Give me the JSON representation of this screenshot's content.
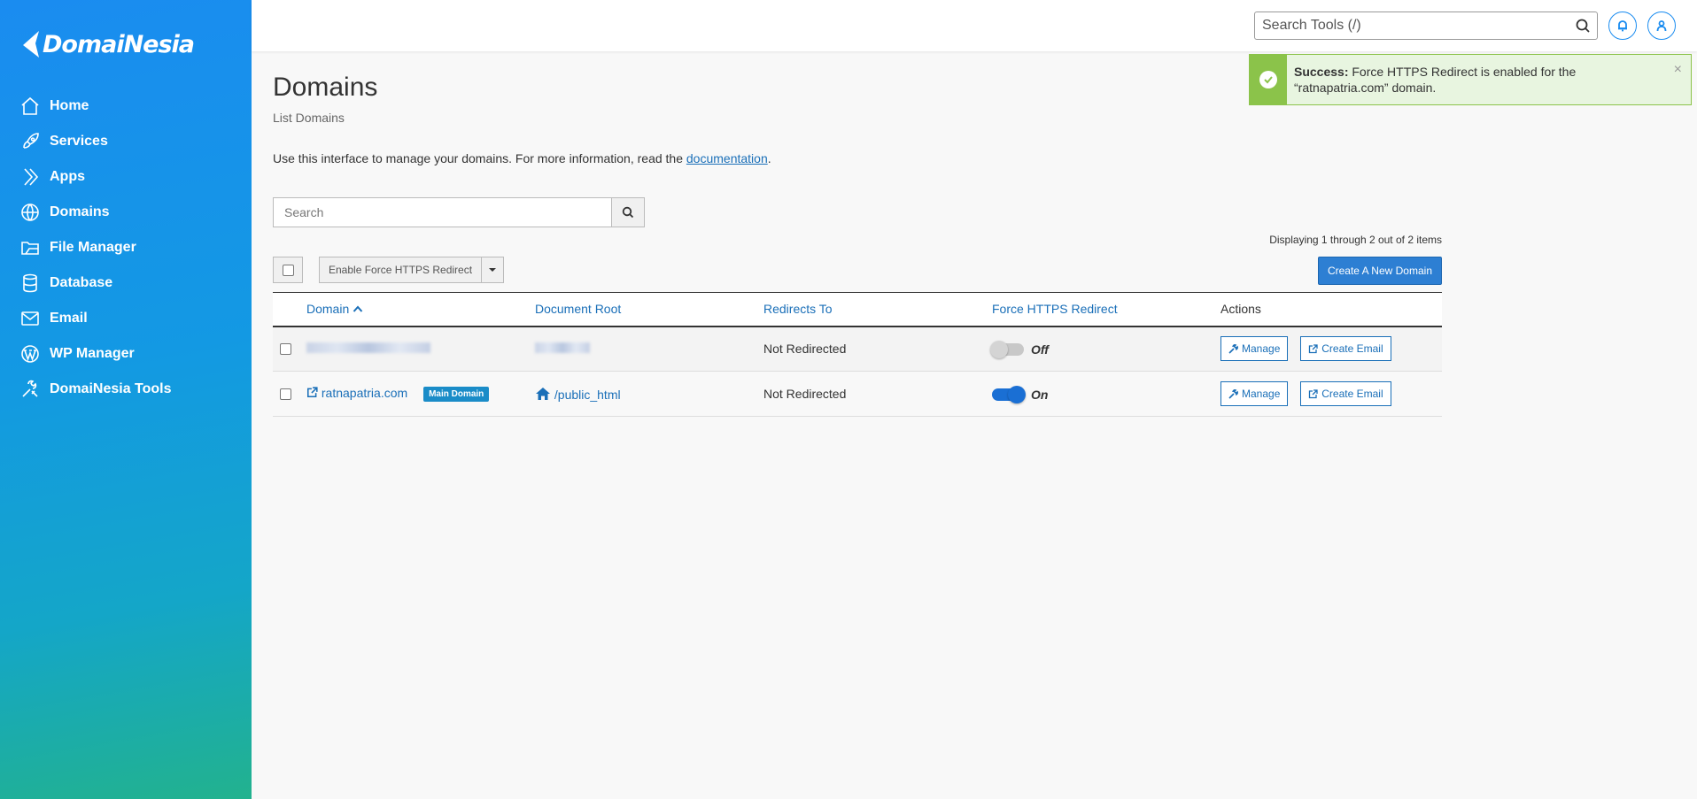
{
  "app": {
    "logo_text": "DomaiNesia"
  },
  "sidebar": {
    "items": [
      {
        "label": "Home",
        "icon": "home-icon"
      },
      {
        "label": "Services",
        "icon": "rocket-icon"
      },
      {
        "label": "Apps",
        "icon": "apps-icon"
      },
      {
        "label": "Domains",
        "icon": "globe-icon"
      },
      {
        "label": "File Manager",
        "icon": "file-manager-icon"
      },
      {
        "label": "Database",
        "icon": "database-icon"
      },
      {
        "label": "Email",
        "icon": "mail-icon"
      },
      {
        "label": "WP Manager",
        "icon": "wordpress-icon"
      },
      {
        "label": "DomaiNesia Tools",
        "icon": "tools-icon"
      }
    ]
  },
  "header": {
    "search_placeholder": "Search Tools (/)"
  },
  "alert": {
    "title": "Success:",
    "message": "Force HTTPS Redirect is enabled for the “ratnapatria.com” domain.",
    "close": "×"
  },
  "main": {
    "title": "Domains",
    "subtitle": "List Domains",
    "intro_text": "Use this interface to manage your domains. For more information, read the ",
    "intro_link": "documentation",
    "intro_end": ".",
    "search_placeholder": "Search",
    "displaying": "Displaying 1 through 2 out of 2 items",
    "bulk_action": "Enable Force HTTPS Redirect",
    "create_button": "Create A New Domain"
  },
  "table": {
    "headers": {
      "domain": "Domain",
      "document_root": "Document Root",
      "redirects_to": "Redirects To",
      "force_https": "Force HTTPS Redirect",
      "actions": "Actions"
    },
    "rows": [
      {
        "domain": "",
        "document_root": "",
        "redirects_to": "Not Redirected",
        "force_https": "Off",
        "manage": "Manage",
        "create_email": "Create Email"
      },
      {
        "domain": "ratnapatria.com",
        "badge": "Main Domain",
        "document_root": "/public_html",
        "redirects_to": "Not Redirected",
        "force_https": "On",
        "manage": "Manage",
        "create_email": "Create Email"
      }
    ]
  },
  "colors": {
    "accent": "#1a8cf0",
    "link": "#1a6fb8",
    "success": "#8bc34a",
    "toggle_on": "#1a6fd4",
    "toggle_off": "#c8c8c8"
  }
}
